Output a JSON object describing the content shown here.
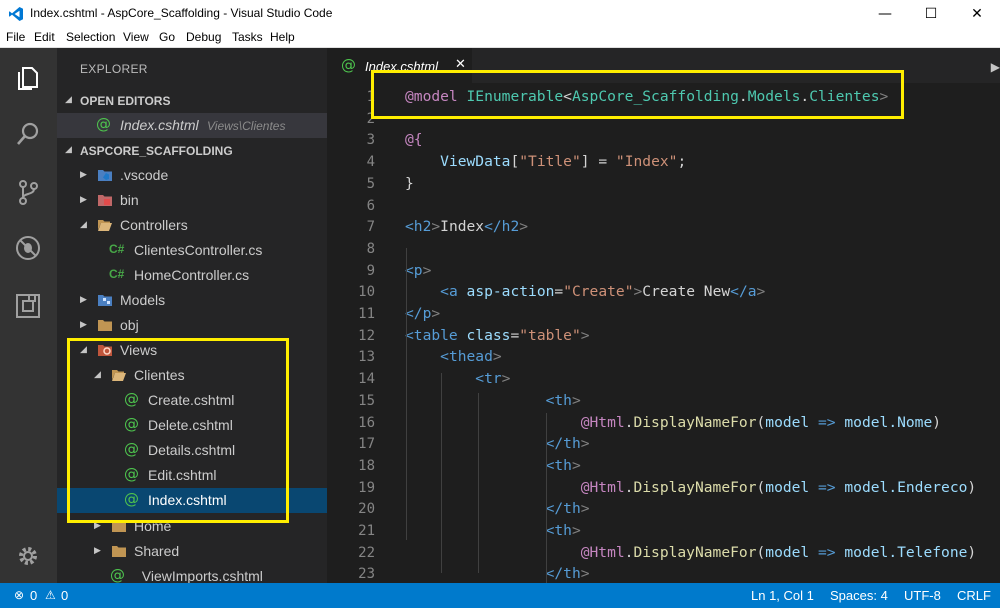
{
  "window": {
    "title": "Index.cshtml - AspCore_Scaffolding - Visual Studio Code",
    "min_glyph": "—",
    "max_glyph": "☐",
    "close_glyph": "✕"
  },
  "menu": [
    "File",
    "Edit",
    "Selection",
    "View",
    "Go",
    "Debug",
    "Tasks",
    "Help"
  ],
  "activity_bar": [
    "files-icon",
    "search-icon",
    "source-control-icon",
    "debug-icon",
    "extensions-icon",
    "settings-icon"
  ],
  "sidebar": {
    "title": "EXPLORER",
    "open_editors_label": "OPEN EDITORS",
    "open_editor": {
      "name": "Index.cshtml",
      "path": "Views\\Clientes"
    },
    "project_label": "ASPCORE_SCAFFOLDING",
    "tree": [
      {
        "label": ".vscode",
        "icon": "vscode-folder-icon"
      },
      {
        "label": "bin",
        "icon": "bin-folder-icon"
      },
      {
        "label": "Controllers",
        "icon": "folder-icon"
      },
      {
        "label": "ClientesController.cs",
        "icon": "csharp-icon"
      },
      {
        "label": "HomeController.cs",
        "icon": "csharp-icon"
      },
      {
        "label": "Models",
        "icon": "models-folder-icon"
      },
      {
        "label": "obj",
        "icon": "folder-icon"
      },
      {
        "label": "Views",
        "icon": "views-folder-icon"
      },
      {
        "label": "Clientes",
        "icon": "folder-icon"
      },
      {
        "label": "Create.cshtml",
        "icon": "razor-icon"
      },
      {
        "label": "Delete.cshtml",
        "icon": "razor-icon"
      },
      {
        "label": "Details.cshtml",
        "icon": "razor-icon"
      },
      {
        "label": "Edit.cshtml",
        "icon": "razor-icon"
      },
      {
        "label": "Index.cshtml",
        "icon": "razor-icon"
      },
      {
        "label": "Home",
        "icon": "folder-icon"
      },
      {
        "label": "Shared",
        "icon": "folder-icon"
      },
      {
        "label": "_ViewImports.cshtml",
        "icon": "razor-icon"
      }
    ],
    "csharp_glyph": "C#",
    "razor_glyph": "@"
  },
  "editor": {
    "tab_label": "Index.cshtml",
    "tab_close": "✕",
    "line_numbers": [
      "1",
      "2",
      "3",
      "4",
      "5",
      "6",
      "7",
      "8",
      "9",
      "10",
      "11",
      "12",
      "13",
      "14",
      "15",
      "16",
      "17",
      "18",
      "19",
      "20",
      "21",
      "22",
      "23"
    ],
    "code_lines": [
      "@model IEnumerable<AspCore_Scaffolding.Models.Clientes>",
      "",
      "@{",
      "    ViewData[\"Title\"] = \"Index\";",
      "}",
      "",
      "<h2>Index</h2>",
      "",
      "<p>",
      "    <a asp-action=\"Create\">Create New</a>",
      "</p>",
      "<table class=\"table\">",
      "    <thead>",
      "        <tr>",
      "                <th>",
      "                    @Html.DisplayNameFor(model => model.Nome)",
      "                </th>",
      "                <th>",
      "                    @Html.DisplayNameFor(model => model.Endereco)",
      "                </th>",
      "                <th>",
      "                    @Html.DisplayNameFor(model => model.Telefone)",
      "                </th>"
    ]
  },
  "status_bar": {
    "errors": "0",
    "warnings": "0",
    "position": "Ln 1, Col 1",
    "spaces": "Spaces: 4",
    "encoding": "UTF-8",
    "eol": "CRLF"
  },
  "colors": {
    "accent": "#007acc",
    "selection": "#094771",
    "highlight_box": "#ffee00"
  }
}
